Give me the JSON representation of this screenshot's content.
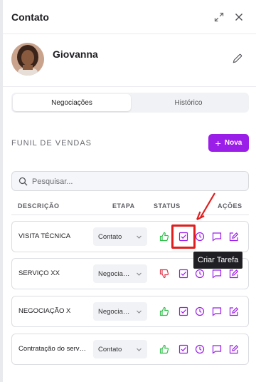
{
  "header": {
    "title": "Contato"
  },
  "contact": {
    "name": "Giovanna"
  },
  "tabs": [
    {
      "label": "Negociações",
      "active": true
    },
    {
      "label": "Histórico",
      "active": false
    }
  ],
  "funnel": {
    "title": "FUNIL DE VENDAS",
    "new_button": {
      "plus": "+",
      "label": "Nova"
    }
  },
  "search": {
    "placeholder": "Pesquisar..."
  },
  "table": {
    "headers": {
      "descricao": "DESCRIÇÃO",
      "etapa": "ETAPA",
      "status": "STATUS",
      "acoes": "AÇÕES"
    },
    "rows": [
      {
        "description": "VISITA TÉCNICA",
        "stage": "Contato",
        "status": "thumbs-up"
      },
      {
        "description": "SERVIÇO XX",
        "stage": "Negociação",
        "status": "thumbs-down"
      },
      {
        "description": "NEGOCIAÇÃO X",
        "stage": "Negociação",
        "status": "thumbs-up"
      },
      {
        "description": "Contratação do serviço",
        "stage": "Contato",
        "status": "thumbs-up"
      }
    ]
  },
  "tooltip": {
    "text": "Criar Tarefa"
  },
  "colors": {
    "accent": "#9b1de8",
    "positive": "#2fbf4a",
    "negative": "#e0364a",
    "highlight": "#e11d1d"
  }
}
